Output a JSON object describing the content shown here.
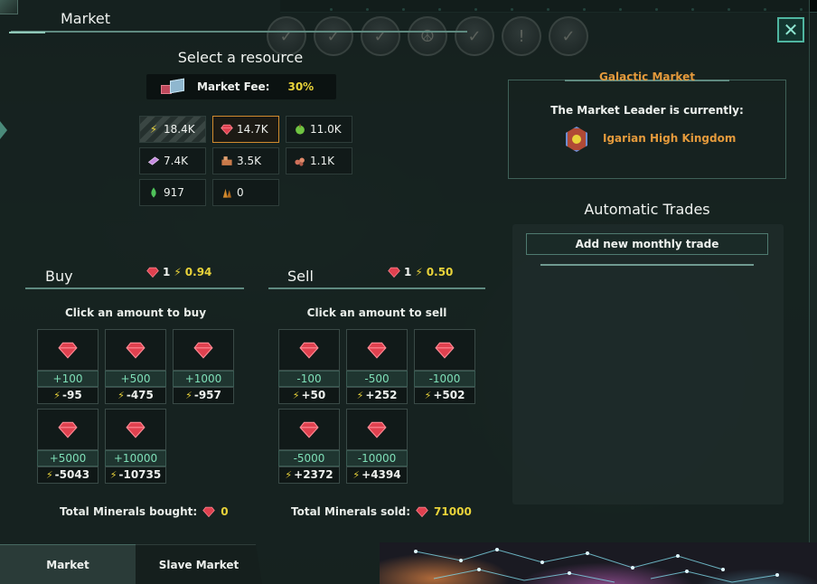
{
  "window": {
    "title": "Market"
  },
  "select_resource": {
    "title": "Select a resource",
    "fee_label": "Market Fee:",
    "fee_value": "30%",
    "resources": [
      {
        "name": "energy",
        "value": "18.4K",
        "icon": "energy-icon",
        "selected": false,
        "hatched": true
      },
      {
        "name": "minerals",
        "value": "14.7K",
        "icon": "mineral-gem-icon",
        "selected": true,
        "hatched": false
      },
      {
        "name": "food",
        "value": "11.0K",
        "icon": "food-icon",
        "selected": false,
        "hatched": false
      },
      {
        "name": "alloys",
        "value": "7.4K",
        "icon": "alloys-icon",
        "selected": false,
        "hatched": false
      },
      {
        "name": "consumer-goods",
        "value": "3.5K",
        "icon": "consumer-goods-icon",
        "selected": false,
        "hatched": false
      },
      {
        "name": "exotic-gases",
        "value": "1.1K",
        "icon": "exotic-gases-icon",
        "selected": false,
        "hatched": false
      },
      {
        "name": "volatile-motes",
        "value": "917",
        "icon": "volatile-motes-icon",
        "selected": false,
        "hatched": false
      },
      {
        "name": "rare-crystals",
        "value": "0",
        "icon": "rare-crystals-icon",
        "selected": false,
        "hatched": false
      }
    ]
  },
  "buy": {
    "title": "Buy",
    "price_qty": "1",
    "price_value": "0.94",
    "hint": "Click an amount to buy",
    "options": [
      {
        "amount": "+100",
        "cost": "-95"
      },
      {
        "amount": "+500",
        "cost": "-475"
      },
      {
        "amount": "+1000",
        "cost": "-957"
      },
      {
        "amount": "+5000",
        "cost": "-5043"
      },
      {
        "amount": "+10000",
        "cost": "-10735"
      }
    ],
    "total_label": "Total Minerals bought:",
    "total_value": "0"
  },
  "sell": {
    "title": "Sell",
    "price_qty": "1",
    "price_value": "0.50",
    "hint": "Click an amount to sell",
    "options": [
      {
        "amount": "-100",
        "cost": "+50"
      },
      {
        "amount": "-500",
        "cost": "+252"
      },
      {
        "amount": "-1000",
        "cost": "+502"
      },
      {
        "amount": "-5000",
        "cost": "+2372"
      },
      {
        "amount": "-10000",
        "cost": "+4394"
      }
    ],
    "total_label": "Total Minerals sold:",
    "total_value": "71000"
  },
  "galactic_market": {
    "title": "Galactic Market",
    "leader_text": "The Market Leader is currently:",
    "leader_name": "Igarian High Kingdom"
  },
  "automatic_trades": {
    "title": "Automatic Trades",
    "add_button": "Add new monthly trade"
  },
  "tabs": {
    "market": "Market",
    "slave_market": "Slave Market"
  },
  "colors": {
    "accent": "#e9d33a",
    "orange": "#e49a3c",
    "buy_green": "#7fe0b8",
    "mineral_red": "#e0414f"
  }
}
